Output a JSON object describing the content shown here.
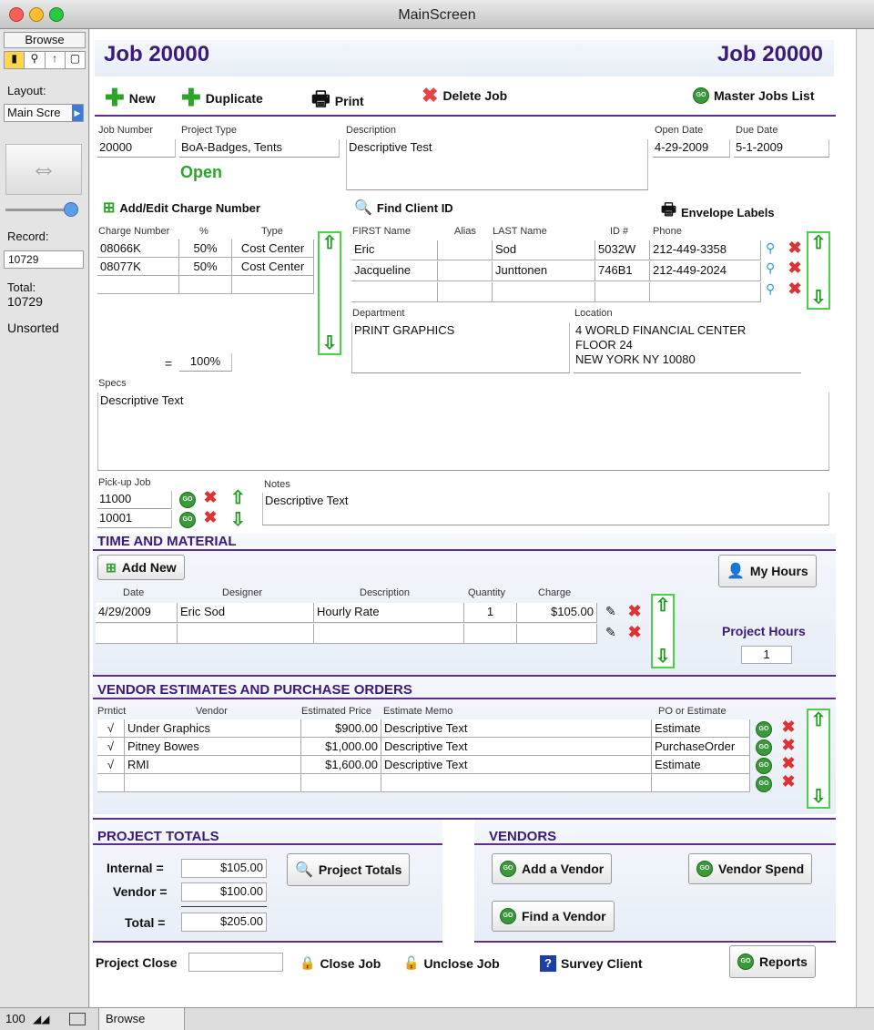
{
  "window": {
    "title": "MainScreen"
  },
  "sidebar": {
    "mode": "Browse",
    "layout_label": "Layout:",
    "layout_value": "Main Scre",
    "record_label": "Record:",
    "record_value": "10729",
    "total_label": "Total:",
    "total_value": "10729",
    "sort_status": "Unsorted"
  },
  "status": {
    "zoom": "100",
    "mode": "Browse"
  },
  "header": {
    "title_left": "Job 20000",
    "title_right": "Job 20000"
  },
  "toolbar": {
    "new": "New",
    "duplicate": "Duplicate",
    "print": "Print",
    "delete": "Delete Job",
    "master": "Master Jobs List"
  },
  "job": {
    "labels": {
      "job_number": "Job Number",
      "project_type": "Project Type",
      "description": "Description",
      "open_date": "Open Date",
      "due_date": "Due Date"
    },
    "job_number": "20000",
    "project_type": "BoA-Badges, Tents",
    "status": "Open",
    "description": "Descriptive Test",
    "open_date": "4-29-2009",
    "due_date": "5-1-2009"
  },
  "charges": {
    "add_label": "Add/Edit Charge Number",
    "headers": {
      "number": "Charge Number",
      "pct": "%",
      "type": "Type"
    },
    "rows": [
      {
        "number": "08066K",
        "pct": "50%",
        "type": "Cost Center"
      },
      {
        "number": "08077K",
        "pct": "50%",
        "type": "Cost Center"
      }
    ],
    "eq": "=",
    "total": "100%"
  },
  "client": {
    "find_label": "Find Client ID",
    "envelope_label": "Envelope Labels",
    "headers": {
      "first": "FIRST Name",
      "alias": "Alias",
      "last": "LAST Name",
      "id": "ID #",
      "phone": "Phone"
    },
    "rows": [
      {
        "first": "Eric",
        "alias": "",
        "last": "Sod",
        "id": "5032W",
        "phone": "212-449-3358"
      },
      {
        "first": "Jacqueline",
        "alias": "",
        "last": "Junttonen",
        "id": "746B1",
        "phone": "212-449-2024"
      }
    ],
    "department_label": "Department",
    "department": "PRINT GRAPHICS",
    "location_label": "Location",
    "location": [
      "4 WORLD FINANCIAL CENTER",
      "FLOOR 24",
      "NEW YORK NY 10080"
    ]
  },
  "specs": {
    "label": "Specs",
    "text": "Descriptive Text"
  },
  "pickup": {
    "label": "Pick-up Job",
    "jobs": [
      "11000",
      "10001"
    ]
  },
  "notes": {
    "label": "Notes",
    "text": "Descriptive Text"
  },
  "tm": {
    "title": "TIME AND MATERIAL",
    "add_new": "Add New",
    "my_hours": "My Hours",
    "headers": {
      "date": "Date",
      "designer": "Designer",
      "description": "Description",
      "quantity": "Quantity",
      "charge": "Charge"
    },
    "rows": [
      {
        "date": "4/29/2009",
        "designer": "Eric Sod",
        "description": "Hourly Rate",
        "quantity": "1",
        "charge": "$105.00"
      }
    ],
    "project_hours_label": "Project Hours",
    "project_hours": "1"
  },
  "vendors_po": {
    "title": "VENDOR ESTIMATES AND PURCHASE ORDERS",
    "headers": {
      "prntct": "Prntict",
      "vendor": "Vendor",
      "price": "Estimated Price",
      "memo": "Estimate Memo",
      "po": "PO or Estimate"
    },
    "rows": [
      {
        "check": "√",
        "vendor": "Under Graphics",
        "price": "$900.00",
        "memo": "Descriptive Text",
        "po": "Estimate"
      },
      {
        "check": "√",
        "vendor": "Pitney Bowes",
        "price": "$1,000.00",
        "memo": "Descriptive Text",
        "po": "PurchaseOrder"
      },
      {
        "check": "√",
        "vendor": "RMI",
        "price": "$1,600.00",
        "memo": "Descriptive Text",
        "po": "Estimate"
      }
    ]
  },
  "totals": {
    "title": "PROJECT TOTALS",
    "internal_label": "Internal =",
    "internal": "$105.00",
    "vendor_label": "Vendor =",
    "vendor": "$100.00",
    "total_label": "Total =",
    "total": "$205.00",
    "button": "Project Totals"
  },
  "vendors": {
    "title": "VENDORS",
    "add": "Add a Vendor",
    "spend": "Vendor Spend",
    "find": "Find a Vendor"
  },
  "footer": {
    "close_label": "Project Close",
    "close_job": "Close Job",
    "unclose_job": "Unclose Job",
    "survey": "Survey Client",
    "reports": "Reports"
  },
  "colors": {
    "accent": "#3c1a78",
    "green": "#3a9a3a",
    "red": "#d33333",
    "panel": "#e8eef7"
  }
}
